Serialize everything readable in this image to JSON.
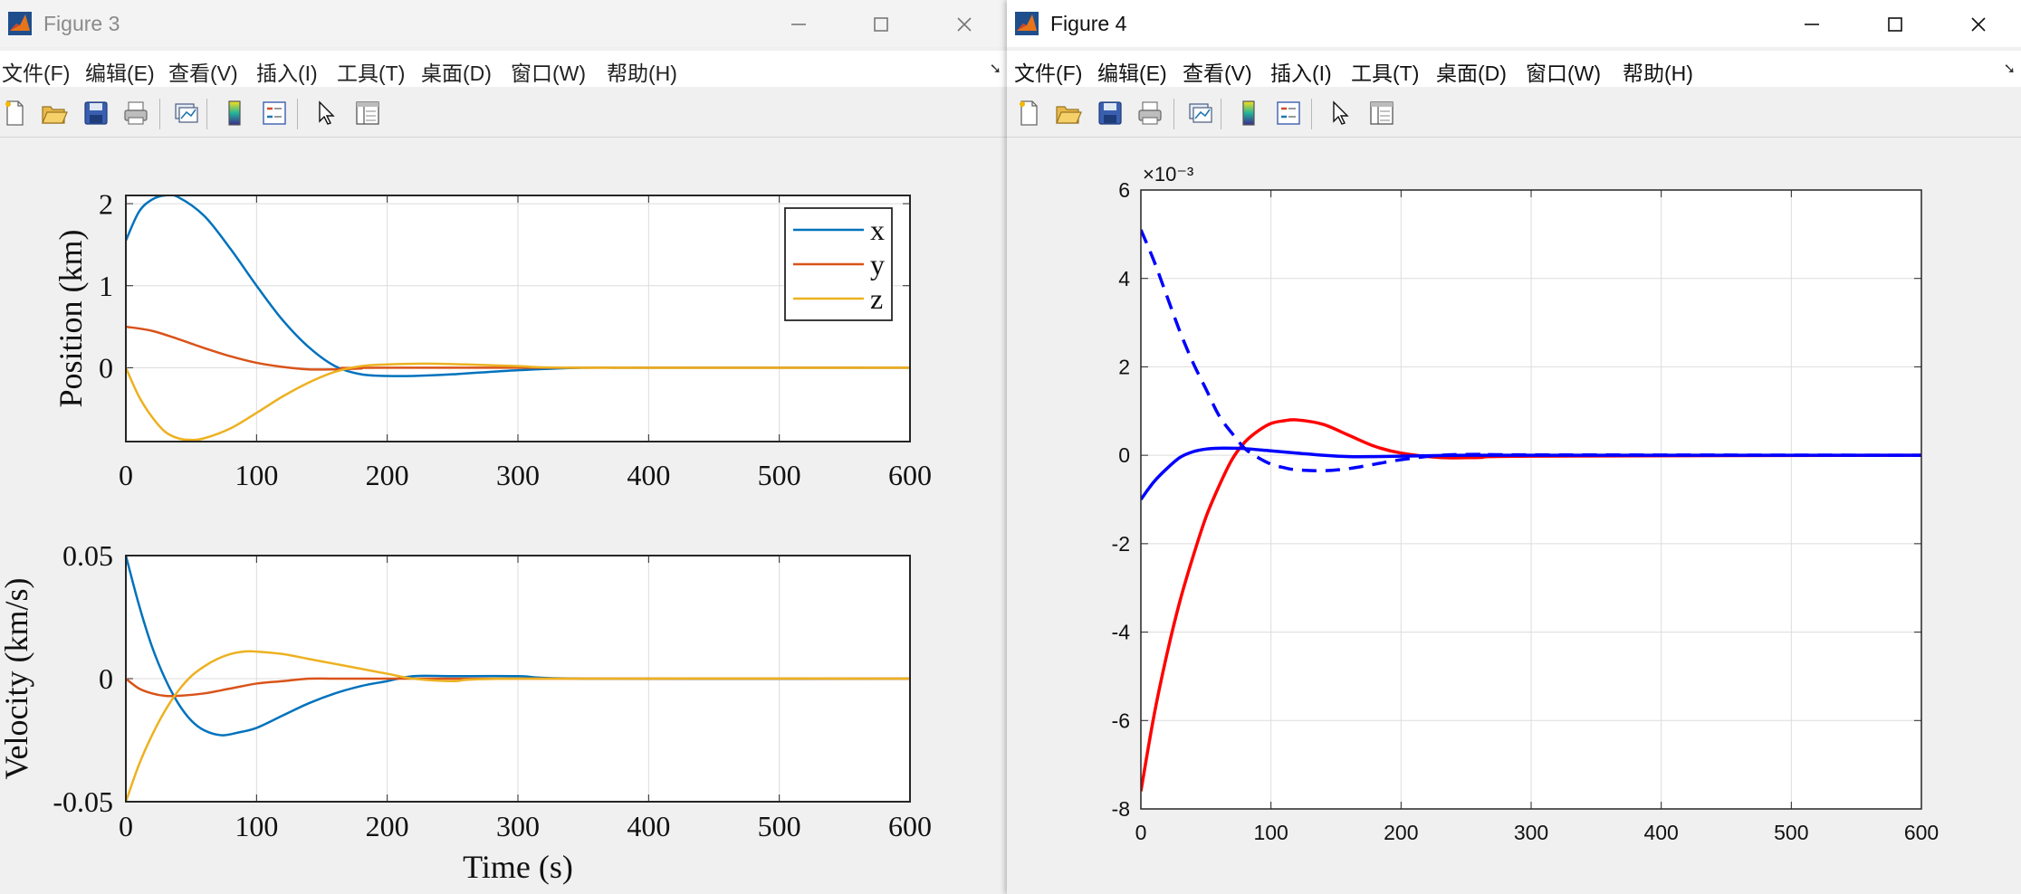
{
  "figure3": {
    "title": "Figure 3",
    "menu": [
      "文件(F)",
      "编辑(E)",
      "查看(V)",
      "插入(I)",
      "工具(T)",
      "桌面(D)",
      "窗口(W)",
      "帮助(H)"
    ]
  },
  "figure4": {
    "title": "Figure 4",
    "menu": [
      "文件(F)",
      "编辑(E)",
      "查看(V)",
      "插入(I)",
      "工具(T)",
      "桌面(D)",
      "窗口(W)",
      "帮助(H)"
    ]
  },
  "toolbar_icons": [
    "new-figure-icon",
    "open-file-icon",
    "save-icon",
    "print-icon",
    "link-plot-icon",
    "colorbar-icon",
    "legend-icon",
    "edit-pointer-icon",
    "property-inspector-icon"
  ],
  "colors": {
    "x": "#0072BD",
    "y": "#D95319",
    "z": "#EDB120",
    "red": "#FF0000",
    "blue": "#0000FF"
  },
  "chart_data": [
    {
      "id": "position",
      "type": "line",
      "title": "",
      "xlabel": "",
      "ylabel": "Position (km)",
      "xlim": [
        0,
        600
      ],
      "ylim": [
        -0.9,
        2.1
      ],
      "xticks": [
        "0",
        "100",
        "200",
        "300",
        "400",
        "500",
        "600"
      ],
      "yticks": [
        "2",
        "1",
        "0"
      ],
      "grid": true,
      "legend_position": "top-right",
      "series": [
        {
          "name": "x",
          "x": [
            0,
            10,
            20,
            30,
            40,
            60,
            80,
            100,
            120,
            140,
            160,
            180,
            200,
            220,
            250,
            300,
            350,
            400,
            600
          ],
          "y": [
            1.55,
            1.9,
            2.05,
            2.1,
            2.08,
            1.85,
            1.45,
            1.0,
            0.58,
            0.25,
            0.02,
            -0.08,
            -0.1,
            -0.1,
            -0.08,
            -0.03,
            0.0,
            0.0,
            0.0
          ]
        },
        {
          "name": "y",
          "x": [
            0,
            20,
            40,
            60,
            80,
            100,
            120,
            140,
            160,
            180,
            200,
            600
          ],
          "y": [
            0.5,
            0.45,
            0.35,
            0.24,
            0.14,
            0.06,
            0.01,
            -0.02,
            -0.02,
            -0.01,
            0.0,
            0.0
          ]
        },
        {
          "name": "z",
          "x": [
            0,
            10,
            20,
            30,
            40,
            50,
            60,
            80,
            100,
            120,
            140,
            160,
            180,
            200,
            230,
            260,
            300,
            350,
            600
          ],
          "y": [
            0.0,
            -0.35,
            -0.6,
            -0.78,
            -0.86,
            -0.88,
            -0.86,
            -0.74,
            -0.55,
            -0.35,
            -0.18,
            -0.05,
            0.02,
            0.04,
            0.05,
            0.04,
            0.02,
            0.0,
            0.0
          ]
        }
      ]
    },
    {
      "id": "velocity",
      "type": "line",
      "title": "",
      "xlabel": "Time (s)",
      "ylabel": "Velocity (km/s)",
      "xlim": [
        0,
        600
      ],
      "ylim": [
        -0.05,
        0.05
      ],
      "xticks": [
        "0",
        "100",
        "200",
        "300",
        "400",
        "500",
        "600"
      ],
      "yticks": [
        "0.05",
        "0",
        "-0.05"
      ],
      "grid": true,
      "series": [
        {
          "name": "x",
          "x": [
            0,
            10,
            20,
            30,
            40,
            50,
            60,
            73,
            85,
            100,
            120,
            140,
            160,
            180,
            200,
            220,
            250,
            300,
            350,
            600
          ],
          "y": [
            0.05,
            0.03,
            0.013,
            0.0,
            -0.01,
            -0.017,
            -0.021,
            -0.023,
            -0.022,
            -0.02,
            -0.015,
            -0.01,
            -0.006,
            -0.003,
            -0.001,
            0.001,
            0.001,
            0.001,
            0.0,
            0.0
          ]
        },
        {
          "name": "y",
          "x": [
            0,
            10,
            20,
            30,
            40,
            60,
            80,
            100,
            120,
            140,
            160,
            200,
            600
          ],
          "y": [
            0.0,
            -0.004,
            -0.006,
            -0.007,
            -0.007,
            -0.006,
            -0.004,
            -0.002,
            -0.001,
            0.0,
            0.0,
            0.0,
            0.0
          ]
        },
        {
          "name": "z",
          "x": [
            0,
            10,
            20,
            30,
            40,
            50,
            60,
            70,
            80,
            90,
            100,
            120,
            140,
            160,
            180,
            200,
            220,
            250,
            300,
            600
          ],
          "y": [
            -0.05,
            -0.035,
            -0.023,
            -0.013,
            -0.005,
            0.001,
            0.005,
            0.008,
            0.01,
            0.011,
            0.011,
            0.01,
            0.008,
            0.006,
            0.004,
            0.002,
            0.0,
            -0.001,
            0.0,
            0.0
          ]
        }
      ]
    },
    {
      "id": "figure4-plot",
      "type": "line",
      "title": "",
      "xlabel": "",
      "ylabel": "",
      "exponent_label": "×10⁻³",
      "xlim": [
        0,
        600
      ],
      "ylim": [
        -8,
        6
      ],
      "xticks": [
        "0",
        "100",
        "200",
        "300",
        "400",
        "500",
        "600"
      ],
      "yticks": [
        "6",
        "4",
        "2",
        "0",
        "-2",
        "-4",
        "-6",
        "-8"
      ],
      "grid": true,
      "series": [
        {
          "color": "#FF0000",
          "dash": false,
          "x": [
            0,
            10,
            20,
            30,
            40,
            50,
            60,
            70,
            80,
            90,
            100,
            110,
            120,
            140,
            160,
            180,
            200,
            230,
            260,
            300,
            600
          ],
          "y": [
            -7.6,
            -5.9,
            -4.5,
            -3.3,
            -2.3,
            -1.4,
            -0.7,
            -0.1,
            0.3,
            0.55,
            0.72,
            0.78,
            0.8,
            0.7,
            0.45,
            0.2,
            0.05,
            -0.05,
            -0.05,
            -0.02,
            0.0
          ]
        },
        {
          "color": "#0000FF",
          "dash": true,
          "x": [
            0,
            10,
            20,
            30,
            40,
            50,
            60,
            70,
            80,
            90,
            100,
            110,
            120,
            140,
            160,
            180,
            200,
            230,
            260,
            300,
            600
          ],
          "y": [
            5.1,
            4.4,
            3.6,
            2.8,
            2.1,
            1.5,
            0.9,
            0.5,
            0.15,
            -0.05,
            -0.2,
            -0.28,
            -0.33,
            -0.35,
            -0.3,
            -0.2,
            -0.1,
            0.0,
            0.02,
            0.01,
            0.0
          ]
        },
        {
          "color": "#0000FF",
          "dash": false,
          "x": [
            0,
            10,
            20,
            30,
            40,
            50,
            60,
            70,
            80,
            100,
            120,
            140,
            160,
            180,
            200,
            250,
            300,
            600
          ],
          "y": [
            -1.0,
            -0.6,
            -0.3,
            -0.05,
            0.08,
            0.14,
            0.16,
            0.16,
            0.15,
            0.1,
            0.05,
            0.0,
            -0.03,
            -0.03,
            -0.02,
            0.0,
            0.0,
            0.0
          ]
        }
      ]
    }
  ]
}
